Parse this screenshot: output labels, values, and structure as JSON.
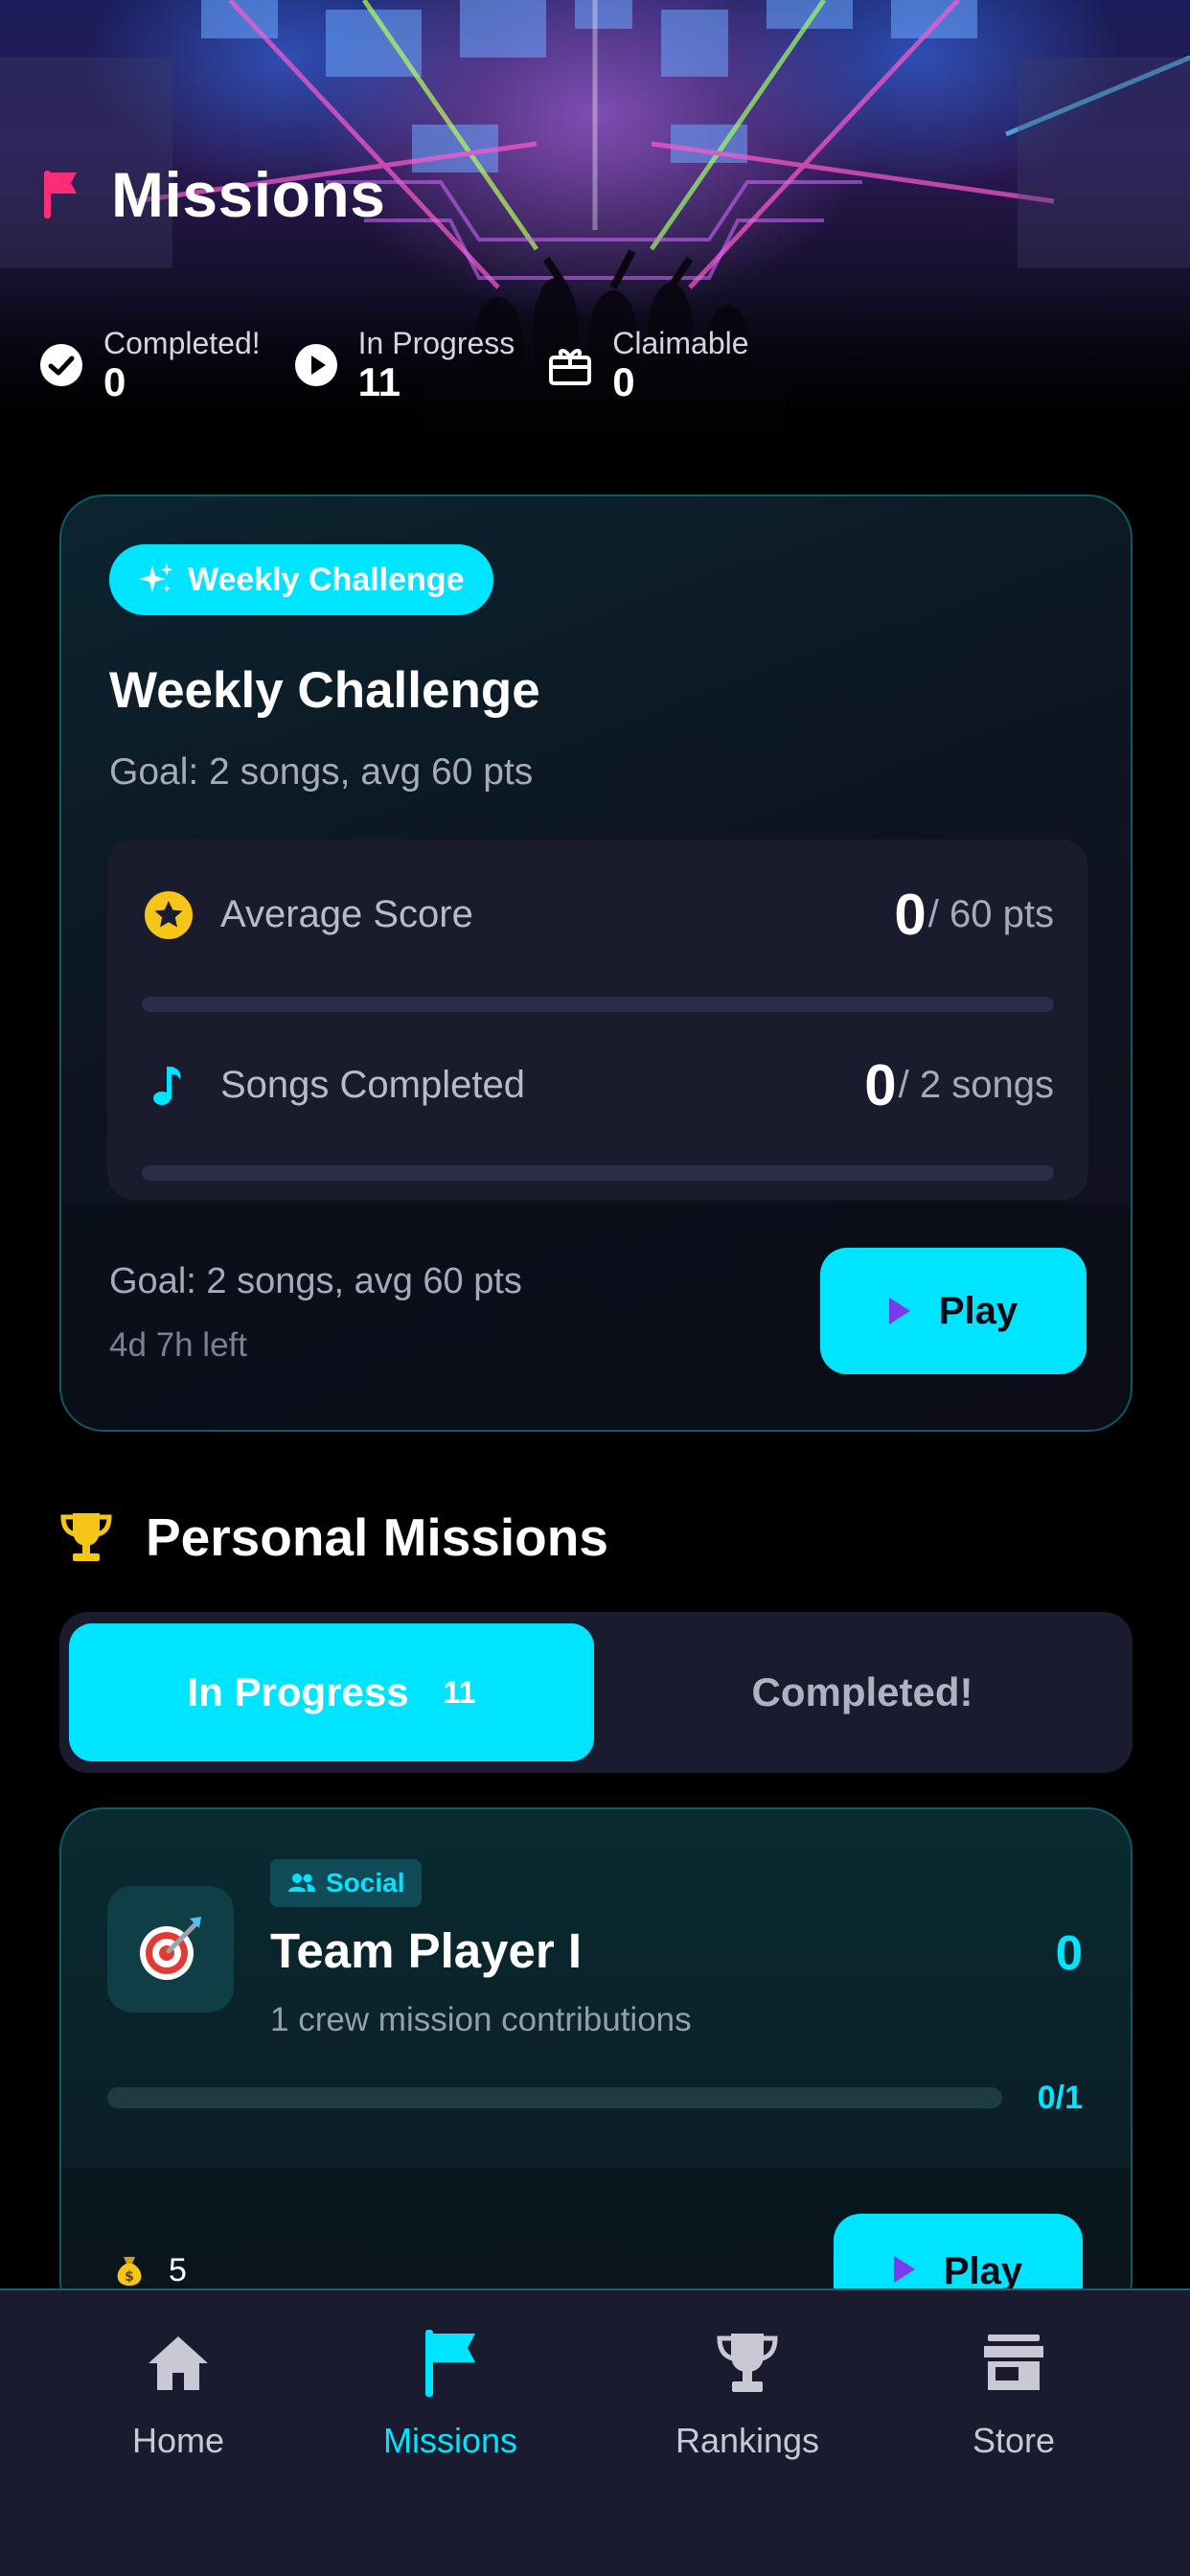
{
  "header": {
    "title": "Missions",
    "icon": "flag-icon",
    "stats": [
      {
        "label": "Completed!",
        "value": "0",
        "icon": "check-circle-icon"
      },
      {
        "label": "In Progress",
        "value": "11",
        "icon": "play-circle-icon"
      },
      {
        "label": "Claimable",
        "value": "0",
        "icon": "gift-icon"
      }
    ]
  },
  "weekly": {
    "badge": "Weekly Challenge",
    "title": "Weekly Challenge",
    "goal": "Goal: 2 songs, avg 60 pts",
    "rows": [
      {
        "label": "Average Score",
        "value": "0",
        "unit": "/ 60 pts",
        "progress": 0,
        "icon": "star-icon"
      },
      {
        "label": "Songs Completed",
        "value": "0",
        "unit": "/ 2 songs",
        "progress": 0,
        "icon": "music-note-icon"
      }
    ],
    "footer_goal": "Goal: 2 songs, avg 60 pts",
    "time_left": "4d 7h left",
    "play_label": "Play"
  },
  "personal": {
    "title": "Personal Missions",
    "icon": "trophy-icon",
    "tabs": {
      "active_label": "In Progress",
      "active_count": "11",
      "inactive_label": "Completed!"
    },
    "mission": {
      "tag": "Social",
      "title": "Team Player I",
      "description": "1 crew mission contributions",
      "score": "0",
      "progress_text": "0/1",
      "progress": 0,
      "reward": "5",
      "play_label": "Play"
    }
  },
  "nav": {
    "items": [
      {
        "label": "Home",
        "icon": "home-icon"
      },
      {
        "label": "Missions",
        "icon": "flag-icon",
        "active": true
      },
      {
        "label": "Rankings",
        "icon": "trophy-icon"
      },
      {
        "label": "Store",
        "icon": "store-icon"
      }
    ]
  },
  "colors": {
    "accent": "#00e5ff",
    "flag": "#ff2d78",
    "gold": "#f5c518",
    "play_triangle": "#7c3aed",
    "nav_bg": "#1b1b2f"
  }
}
